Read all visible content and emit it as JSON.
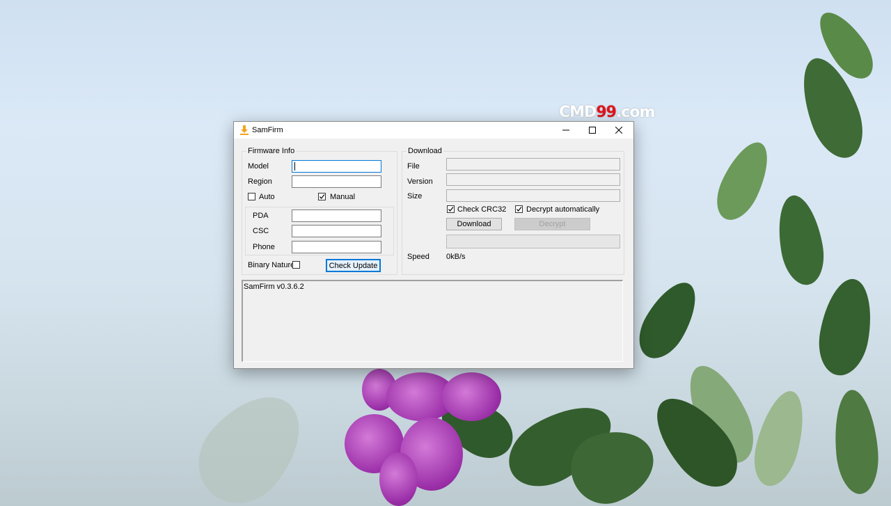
{
  "watermark": {
    "prefix": "CMD",
    "number": "99",
    "suffix": ".com"
  },
  "window": {
    "title": "SamFirm",
    "icon": "download-arrow-icon",
    "controls": {
      "minimize": "minimize-icon",
      "maximize": "maximize-icon",
      "close": "close-icon"
    }
  },
  "firmware_info": {
    "label": "Firmware Info",
    "model": {
      "label": "Model",
      "value": ""
    },
    "region": {
      "label": "Region",
      "value": ""
    },
    "auto": {
      "label": "Auto",
      "checked": false
    },
    "manual": {
      "label": "Manual",
      "checked": true
    },
    "pda": {
      "label": "PDA",
      "value": ""
    },
    "csc": {
      "label": "CSC",
      "value": ""
    },
    "phone": {
      "label": "Phone",
      "value": ""
    },
    "binary_nature": {
      "label": "Binary Nature",
      "checked": false
    },
    "check_update_label": "Check Update"
  },
  "download": {
    "label": "Download",
    "file": {
      "label": "File",
      "value": ""
    },
    "version": {
      "label": "Version",
      "value": ""
    },
    "size": {
      "label": "Size",
      "value": ""
    },
    "check_crc32": {
      "label": "Check CRC32",
      "checked": true
    },
    "decrypt_auto": {
      "label": "Decrypt automatically",
      "checked": true
    },
    "download_label": "Download",
    "decrypt_label": "Decrypt",
    "progress": 0,
    "speed_label": "Speed",
    "speed_value": "0kB/s"
  },
  "log": {
    "text": "SamFirm v0.3.6.2"
  },
  "colors": {
    "accent": "#0078d7",
    "icon_orange": "#f2a41c",
    "watermark_red": "#e0151b"
  }
}
